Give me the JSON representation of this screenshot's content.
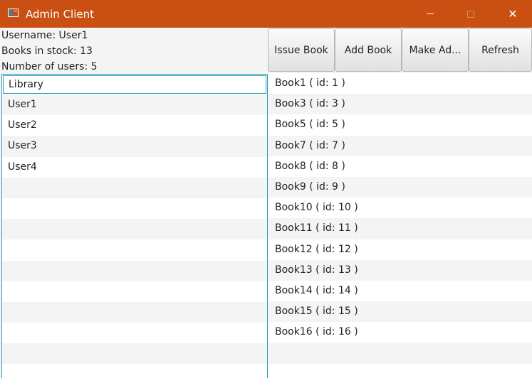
{
  "window": {
    "title": "Admin Client",
    "accent_color": "#c94f12",
    "icon": "app-window-icon",
    "controls": [
      "minimize-icon",
      "maximize-icon",
      "close-icon"
    ],
    "close_glyph": "✕"
  },
  "info": {
    "username": "Username: User1",
    "books_in_stock": "Books in stock: 13",
    "number_of_users": "Number of users: 5"
  },
  "toolbar": {
    "issue_book": "Issue Book",
    "add_book": "Add Book",
    "make_admin": "Make Ad...",
    "refresh": "Refresh"
  },
  "users": [
    "Library",
    "User1",
    "User2",
    "User3",
    "User4"
  ],
  "books": [
    "Book1 ( id: 1 )",
    "Book3 ( id: 3 )",
    "Book5 ( id: 5 )",
    "Book7 ( id: 7 )",
    "Book8 ( id: 8 )",
    "Book9 ( id: 9 )",
    "Book10 ( id: 10 )",
    "Book11 ( id: 11 )",
    "Book12 ( id: 12 )",
    "Book13 ( id: 13 )",
    "Book14 ( id: 14 )",
    "Book15 ( id: 15 )",
    "Book16 ( id: 16 )"
  ],
  "focus_color": "#2a9fb8"
}
